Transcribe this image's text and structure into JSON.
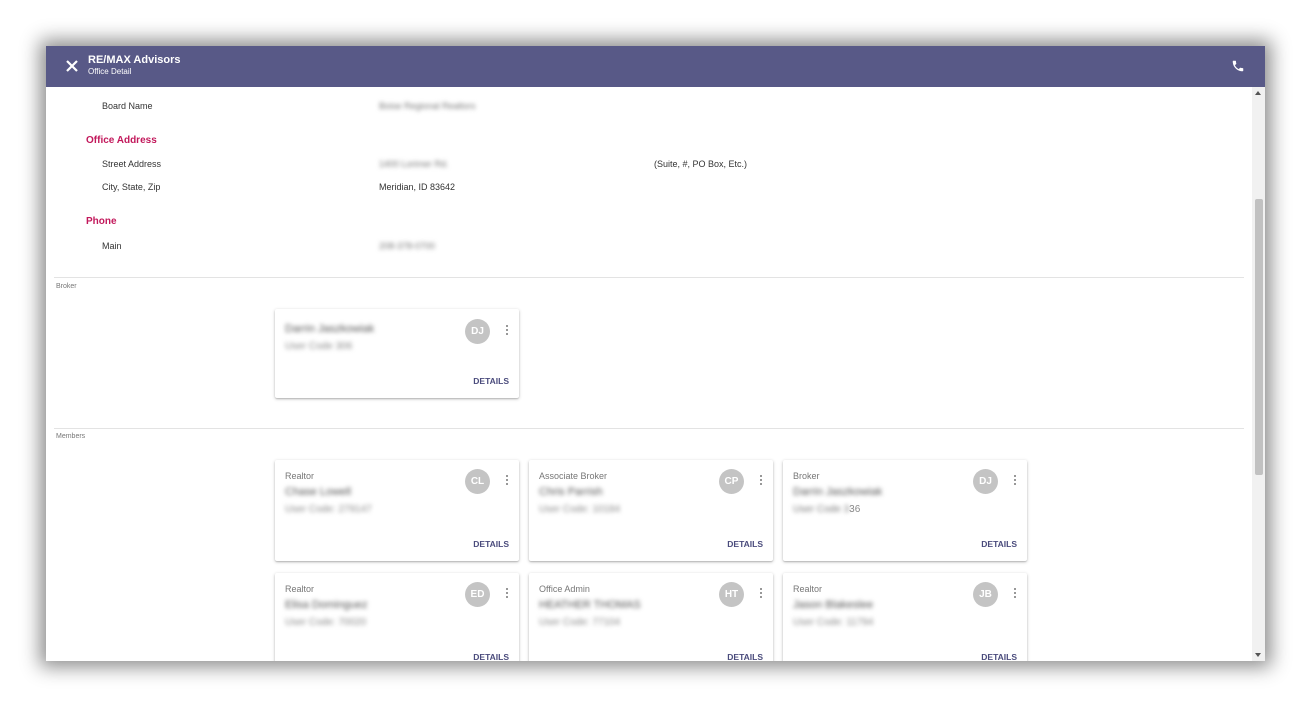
{
  "header": {
    "title": "RE/MAX Advisors",
    "subtitle": "Office Detail"
  },
  "office": {
    "board_label": "Board Name",
    "board_value": "Boise Regional Realtors",
    "address_section": "Office Address",
    "street_label": "Street Address",
    "street_value": "1400 Lorimer Rd.",
    "street_hint": "(Suite, #, PO Box, Etc.)",
    "city_label": "City, State, Zip",
    "city_value": "Meridian, ID 83642",
    "phone_section": "Phone",
    "main_label": "Main",
    "main_value": "208-378-0700"
  },
  "broker_section": {
    "label": "Broker",
    "card": {
      "name": "Darrin Jaszkowiak",
      "code": "User Code 306",
      "initials": "DJ",
      "details_label": "DETAILS"
    }
  },
  "members_section": {
    "label": "Members",
    "cards": [
      {
        "role": "Realtor",
        "name": "Chase Lowell",
        "code": "User Code: 279147",
        "initials": "CL",
        "details_label": "DETAILS"
      },
      {
        "role": "Associate Broker",
        "name": "Chris Parrish",
        "code": "User Code: 10184",
        "initials": "CP",
        "details_label": "DETAILS"
      },
      {
        "role": "Broker",
        "name": "Darrin Jaszkowiak",
        "code": "User Code 3",
        "code_tail": "36",
        "initials": "DJ",
        "details_label": "DETAILS"
      },
      {
        "role": "Realtor",
        "name": "Elisa Dominguez",
        "code": "User Code: 70020",
        "initials": "ED",
        "details_label": "DETAILS"
      },
      {
        "role": "Office Admin",
        "name": "HEATHER THOMAS",
        "code": "User Code: 77104",
        "initials": "HT",
        "details_label": "DETAILS"
      },
      {
        "role": "Realtor",
        "name": "Jason Blakeslee",
        "code": "User Code: 11794",
        "initials": "JB",
        "details_label": "DETAILS"
      }
    ]
  },
  "colors": {
    "appbar": "#585987",
    "section_title": "#c2185b",
    "details_text": "#4a4b7c",
    "avatar": "#c4c4c4"
  }
}
